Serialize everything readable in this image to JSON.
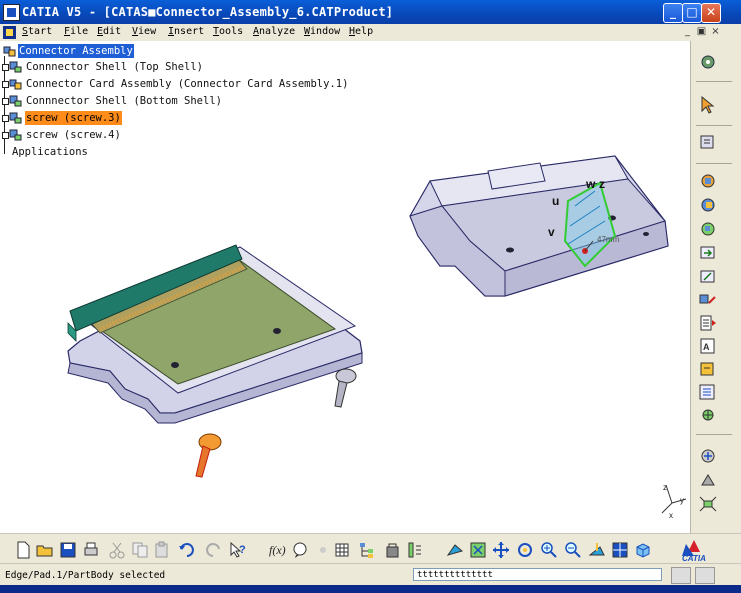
{
  "window": {
    "title": "CATIA V5 - [CATAS■Connector_Assembly_6.CATProduct]",
    "minimize_glyph": "_",
    "maximize_glyph": "□",
    "close_glyph": "✕"
  },
  "menu": {
    "items": [
      "Start",
      "File",
      "Edit",
      "View",
      "Insert",
      "Tools",
      "Analyze",
      "Window",
      "Help"
    ],
    "mdi_min_glyph": "_",
    "mdi_restore_glyph": "▣",
    "mdi_close_glyph": "×"
  },
  "tree": {
    "root": "Connector Assembly",
    "children": [
      "Connnector Shell (Top Shell)",
      "Connector Card Assembly (Connector Card Assembly.1)",
      "Connnector Shell (Bottom Shell)",
      "screw (screw.3)",
      "screw (screw.4)"
    ],
    "applications": "Applications"
  },
  "viewport": {
    "compass_labels": {
      "w": "w",
      "z": "z",
      "u": "u",
      "v": "v"
    },
    "measure_label": "47mm",
    "axis_labels": {
      "z": "z",
      "y": "y",
      "x": "x"
    }
  },
  "status": {
    "message": "Edge/Pad.1/PartBody selected",
    "command_value": "tttttttttttttt"
  },
  "brand": {
    "logo_text": "CATIA"
  },
  "colors": {
    "title_blue": "#0848b8",
    "selection_blue": "#1f5fd6",
    "highlight_orange": "#ff8c1a",
    "part_fill": "#cfcfe6",
    "part_edge": "#2a2a66",
    "pcb_green": "#8fa56a",
    "connector_teal": "#1f7a6a"
  }
}
